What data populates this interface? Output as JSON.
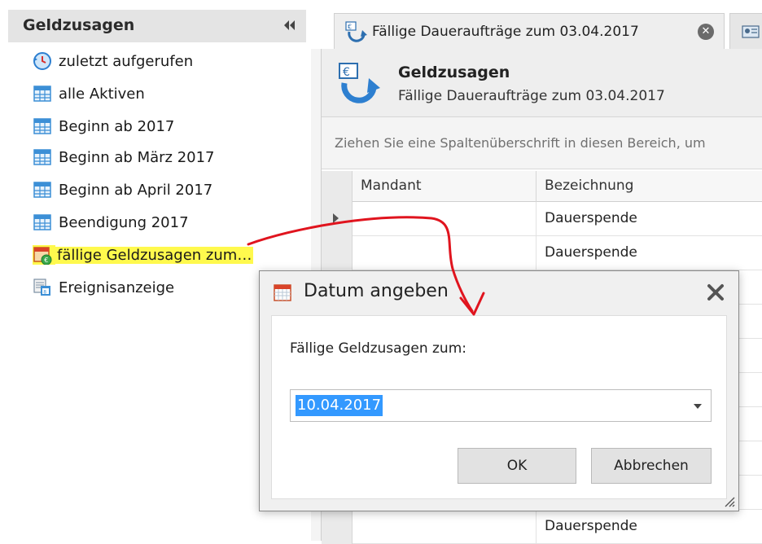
{
  "sidebar": {
    "title": "Geldzusagen",
    "items": [
      {
        "label": "zuletzt aufgerufen",
        "icon": "recent-clock-icon"
      },
      {
        "label": "alle Aktiven",
        "icon": "grid-view-icon"
      },
      {
        "label": "Beginn ab 2017",
        "icon": "grid-view-icon"
      },
      {
        "label": "Beginn ab März 2017",
        "icon": "grid-view-icon"
      },
      {
        "label": "Beginn ab April 2017",
        "icon": "grid-view-icon"
      },
      {
        "label": "Beendigung 2017",
        "icon": "grid-view-icon"
      },
      {
        "label": "fällige Geldzusagen zum…",
        "icon": "calendar-money-icon",
        "highlighted": true
      },
      {
        "label": "Ereignisanzeige",
        "icon": "event-viewer-icon"
      }
    ],
    "highlight_color": "#fff94d"
  },
  "tabs": [
    {
      "label": "Fällige Daueraufträge zum 03.04.2017",
      "active": true,
      "icon": "recurring-money-icon"
    },
    {
      "label": "",
      "active": false,
      "icon": "contact-card-icon"
    }
  ],
  "document": {
    "header_title": "Geldzusagen",
    "header_subtitle": "Fällige Daueraufträge zum 03.04.2017",
    "group_hint": "Ziehen Sie eine Spaltenüberschrift in diesen Bereich, um",
    "columns": [
      "Mandant",
      "Bezeichnung"
    ],
    "rows": [
      {
        "mandant": "",
        "bezeichnung": "Dauerspende"
      },
      {
        "mandant": "",
        "bezeichnung": "Dauerspende"
      },
      {
        "mandant": "",
        "bezeichnung": ""
      },
      {
        "mandant": "",
        "bezeichnung": ""
      },
      {
        "mandant": "",
        "bezeichnung": ""
      },
      {
        "mandant": "",
        "bezeichnung": ""
      },
      {
        "mandant": "",
        "bezeichnung": ""
      },
      {
        "mandant": "",
        "bezeichnung": ""
      },
      {
        "mandant": "",
        "bezeichnung": ""
      },
      {
        "mandant": "",
        "bezeichnung": "Dauerspende"
      }
    ]
  },
  "dialog": {
    "title": "Datum angeben",
    "prompt": "Fällige Geldzusagen zum:",
    "date_value": "10.04.2017",
    "ok_label": "OK",
    "cancel_label": "Abbrechen"
  },
  "colors": {
    "selection": "#3399ff",
    "annotation_arrow": "#e0141e"
  }
}
